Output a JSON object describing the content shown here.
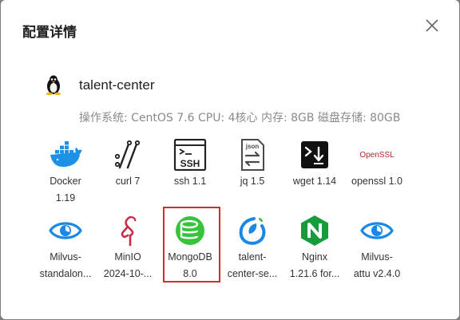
{
  "dialog": {
    "title": "配置详情",
    "close_icon": "close-icon"
  },
  "host": {
    "icon": "linux-tux-icon",
    "name": "talent-center",
    "sysinfo": "操作系统: CentOS 7.6 CPU: 4核心 内存: 8GB 磁盘存储: 80GB"
  },
  "components": [
    {
      "icon": "docker-icon",
      "line1": "Docker",
      "line2": "1.19",
      "selected": false
    },
    {
      "icon": "curl-icon",
      "line1": "curl 7",
      "line2": "",
      "selected": false
    },
    {
      "icon": "ssh-icon",
      "line1": "ssh 1.1",
      "line2": "",
      "selected": false
    },
    {
      "icon": "json-jq-icon",
      "line1": "jq 1.5",
      "line2": "",
      "selected": false
    },
    {
      "icon": "wget-terminal-icon",
      "line1": "wget 1.14",
      "line2": "",
      "selected": false
    },
    {
      "icon": "openssl-icon",
      "icon_text": "OpenSSL",
      "line1": "openssl 1.0",
      "line2": "",
      "selected": false
    },
    {
      "icon": "milvus-eye-icon",
      "line1": "Milvus-",
      "line2": "standalon...",
      "selected": false
    },
    {
      "icon": "minio-icon",
      "line1": "MinIO",
      "line2": "2024-10-...",
      "selected": false
    },
    {
      "icon": "mongodb-icon",
      "line1": "MongoDB",
      "line2": "8.0",
      "selected": true
    },
    {
      "icon": "talent-center-icon",
      "line1": "talent-",
      "line2": "center-se...",
      "selected": false
    },
    {
      "icon": "nginx-icon",
      "line1": "Nginx",
      "line2": "1.21.6 for...",
      "selected": false
    },
    {
      "icon": "milvus-eye-icon",
      "line1": "Milvus-",
      "line2": "attu v2.4.0",
      "selected": false
    }
  ],
  "colors": {
    "selection_border": "#d62b2b",
    "docker_blue": "#1d91e6",
    "milvus_blue": "#1a88e6",
    "mongodb_green": "#39c23b",
    "nginx_green": "#169c3b",
    "minio_red": "#c72c48"
  }
}
